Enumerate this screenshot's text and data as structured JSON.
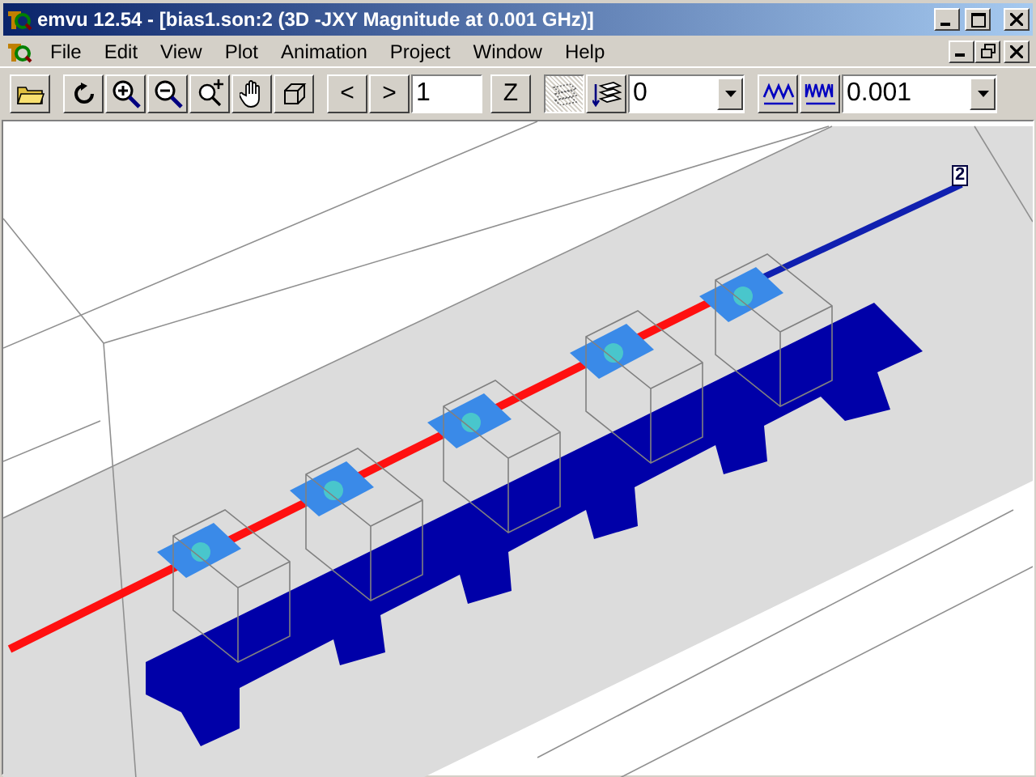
{
  "window": {
    "title": "emvu 12.54 - [bias1.son:2 (3D -JXY Magnitude at 0.001 GHz)]"
  },
  "menu": [
    "File",
    "Edit",
    "View",
    "Plot",
    "Animation",
    "Project",
    "Window",
    "Help"
  ],
  "toolbar": {
    "prev_button": "<",
    "next_button": ">",
    "frame_field": {
      "value": "1"
    },
    "z_button": "Z",
    "mesh_button": {
      "pressed": true
    },
    "level_combo": {
      "value": "0"
    },
    "frequency_combo": {
      "value": "0.001"
    }
  },
  "canvas": {
    "port_label": "2"
  }
}
